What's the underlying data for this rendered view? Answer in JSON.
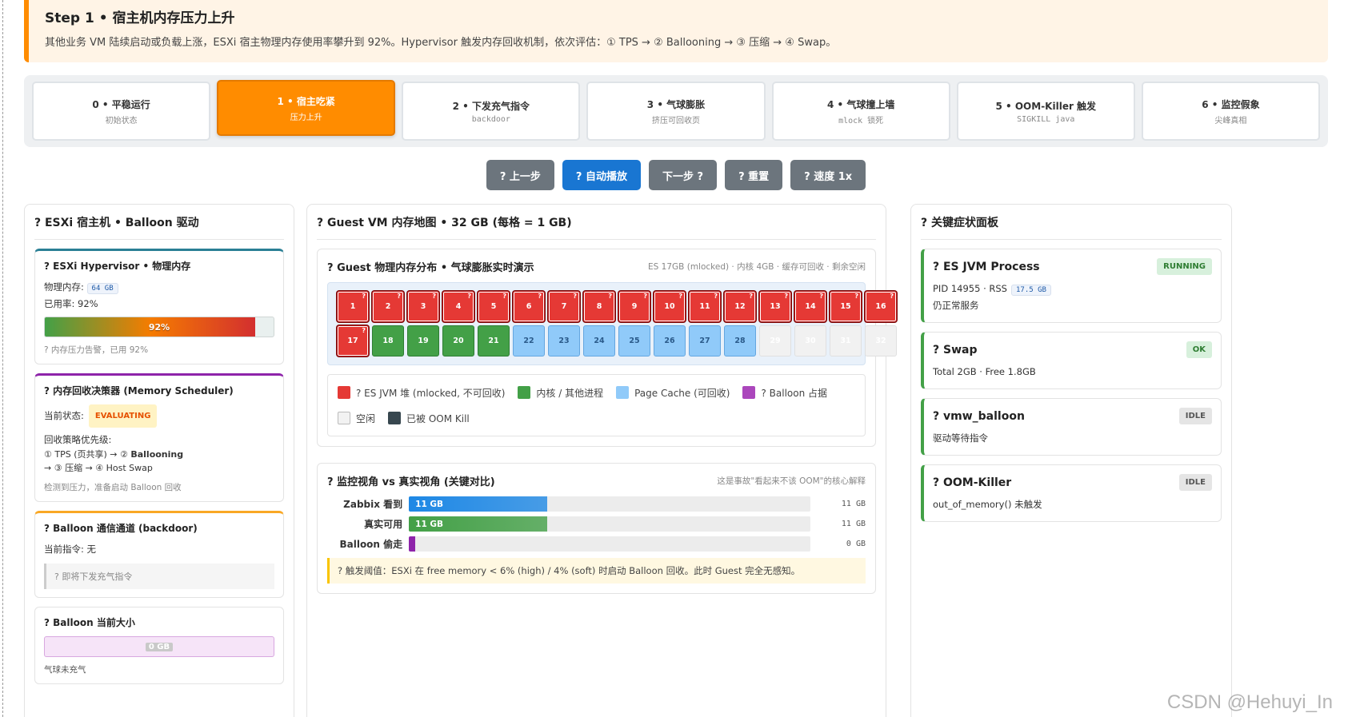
{
  "step": {
    "title": "Step 1 • 宿主机内存压力上升",
    "desc": "其他业务 VM 陆续启动或负载上涨，ESXi 宿主物理内存使用率攀升到 92%。Hypervisor 触发内存回收机制，依次评估：① TPS → ② Ballooning → ③ 压缩 → ④ Swap。"
  },
  "steps": [
    {
      "title": "0 • 平稳运行",
      "sub": "初始状态",
      "active": false
    },
    {
      "title": "1 • 宿主吃紧",
      "sub": "压力上升",
      "active": true
    },
    {
      "title": "2 • 下发充气指令",
      "sub": "backdoor",
      "active": false
    },
    {
      "title": "3 • 气球膨胀",
      "sub": "挤压可回收页",
      "active": false
    },
    {
      "title": "4 • 气球撞上墙",
      "sub": "mlock 锁死",
      "active": false
    },
    {
      "title": "5 • OOM-Killer 触发",
      "sub": "SIGKILL java",
      "active": false
    },
    {
      "title": "6 • 监控假象",
      "sub": "尖峰真相",
      "active": false
    }
  ],
  "controls": {
    "prev": "? 上一步",
    "auto": "? 自动播放",
    "next": "下一步 ?",
    "reset": "? 重置",
    "speed": "? 速度 1x"
  },
  "left": {
    "title": "? ESXi 宿主机 • Balloon 驱动",
    "hyper": {
      "title": "? ESXi Hypervisor • 物理内存",
      "mem_label": "物理内存:",
      "mem_value": "64 GB",
      "used_text": "已用率: 92%",
      "used_percent": 92,
      "bar_label": "92%",
      "note": "? 内存压力告警，已用 92%"
    },
    "scheduler": {
      "title": "? 内存回收决策器 (Memory Scheduler)",
      "state_label": "当前状态:",
      "state": "EVALUATING",
      "prio_label": "回收策略优先级:",
      "line1_a": "① TPS (页共享) → ②",
      "line1_b": "Ballooning",
      "line2": "→ ③ 压缩 → ④ Host Swap",
      "note": "检测到压力，准备启动 Balloon 回收"
    },
    "channel": {
      "title": "? Balloon 通信通道 (backdoor)",
      "cmd": "当前指令: 无",
      "hint": "? 即将下发充气指令"
    },
    "size": {
      "title": "? Balloon 当前大小",
      "value": "0 GB",
      "note": "气球未充气"
    }
  },
  "center": {
    "title": "? Guest VM 内存地图 • 32 GB (每格 = 1 GB)",
    "map": {
      "title": "? Guest 物理内存分布 • 气球膨胀实时演示",
      "summary": "ES 17GB (mlocked) · 内核 4GB · 缓存可回收 · 剩余空闲"
    },
    "cells": [
      {
        "n": "1",
        "k": "es"
      },
      {
        "n": "2",
        "k": "es"
      },
      {
        "n": "3",
        "k": "es"
      },
      {
        "n": "4",
        "k": "es"
      },
      {
        "n": "5",
        "k": "es"
      },
      {
        "n": "6",
        "k": "es"
      },
      {
        "n": "7",
        "k": "es"
      },
      {
        "n": "8",
        "k": "es"
      },
      {
        "n": "9",
        "k": "es"
      },
      {
        "n": "10",
        "k": "es"
      },
      {
        "n": "11",
        "k": "es"
      },
      {
        "n": "12",
        "k": "es"
      },
      {
        "n": "13",
        "k": "es"
      },
      {
        "n": "14",
        "k": "es"
      },
      {
        "n": "15",
        "k": "es"
      },
      {
        "n": "16",
        "k": "es"
      },
      {
        "n": "17",
        "k": "es"
      },
      {
        "n": "18",
        "k": "kernel"
      },
      {
        "n": "19",
        "k": "kernel"
      },
      {
        "n": "20",
        "k": "kernel"
      },
      {
        "n": "21",
        "k": "kernel"
      },
      {
        "n": "22",
        "k": "cache"
      },
      {
        "n": "23",
        "k": "cache"
      },
      {
        "n": "24",
        "k": "cache"
      },
      {
        "n": "25",
        "k": "cache"
      },
      {
        "n": "26",
        "k": "cache"
      },
      {
        "n": "27",
        "k": "cache"
      },
      {
        "n": "28",
        "k": "cache"
      },
      {
        "n": "29",
        "k": "free"
      },
      {
        "n": "30",
        "k": "free"
      },
      {
        "n": "31",
        "k": "free"
      },
      {
        "n": "32",
        "k": "free"
      }
    ],
    "cell_mark": "?",
    "legend": [
      {
        "label": "? ES JVM 堆 (mlocked, 不可回收)",
        "color": "#e53935"
      },
      {
        "label": "内核 / 其他进程",
        "color": "#43a047"
      },
      {
        "label": "Page Cache (可回收)",
        "color": "#90caf9"
      },
      {
        "label": "? Balloon 占据",
        "color": "#ab47bc"
      },
      {
        "label": "空闲",
        "color": "#f2f2f2"
      },
      {
        "label": "已被 OOM Kill",
        "color": "#37474f"
      }
    ],
    "compare": {
      "title": "? 监控视角 vs 真实视角 (关键对比)",
      "note": "这是事故\"看起来不该 OOM\"的核心解释",
      "rows": [
        {
          "label": "Zabbix 看到",
          "value": 11,
          "max": 32,
          "fill": "11 GB",
          "right": "11 GB",
          "color": "#1e88e5"
        },
        {
          "label": "真实可用",
          "value": 11,
          "max": 32,
          "fill": "11 GB",
          "right": "11 GB",
          "color": "#43a047"
        },
        {
          "label": "Balloon 偷走",
          "value": 0,
          "max": 32,
          "fill": "",
          "right": "0 GB",
          "color": "#8e24aa"
        }
      ],
      "warn": "? 触发阈值：ESXi 在 free memory < 6% (high) / 4% (soft) 时启动 Balloon 回收。此时 Guest 完全无感知。"
    }
  },
  "right": {
    "title": "? 关键症状面板",
    "items": [
      {
        "title": "? ES JVM Process",
        "badge": "RUNNING",
        "badge_bg": "#d7f0dc",
        "badge_fg": "#2e7d32",
        "line1": "PID 14955 · RSS",
        "code": "17.5 GB",
        "line2": "仍正常服务"
      },
      {
        "title": "? Swap",
        "badge": "OK",
        "badge_bg": "#d7f0dc",
        "badge_fg": "#2e7d32",
        "line1": "Total 2GB · Free 1.8GB"
      },
      {
        "title": "? vmw_balloon",
        "badge": "IDLE",
        "badge_bg": "#e5e5e5",
        "badge_fg": "#555",
        "line1": "驱动等待指令"
      },
      {
        "title": "? OOM-Killer",
        "badge": "IDLE",
        "badge_bg": "#e5e5e5",
        "badge_fg": "#555",
        "line1": "out_of_memory() 未触发"
      }
    ]
  },
  "watermark": "CSDN @Hehuyi_In",
  "colors": {
    "accent": "#ff8c00",
    "primary": "#1976d2",
    "es": "#e53935",
    "kernel": "#43a047",
    "cache": "#90caf9",
    "free": "#f2f2f2"
  }
}
